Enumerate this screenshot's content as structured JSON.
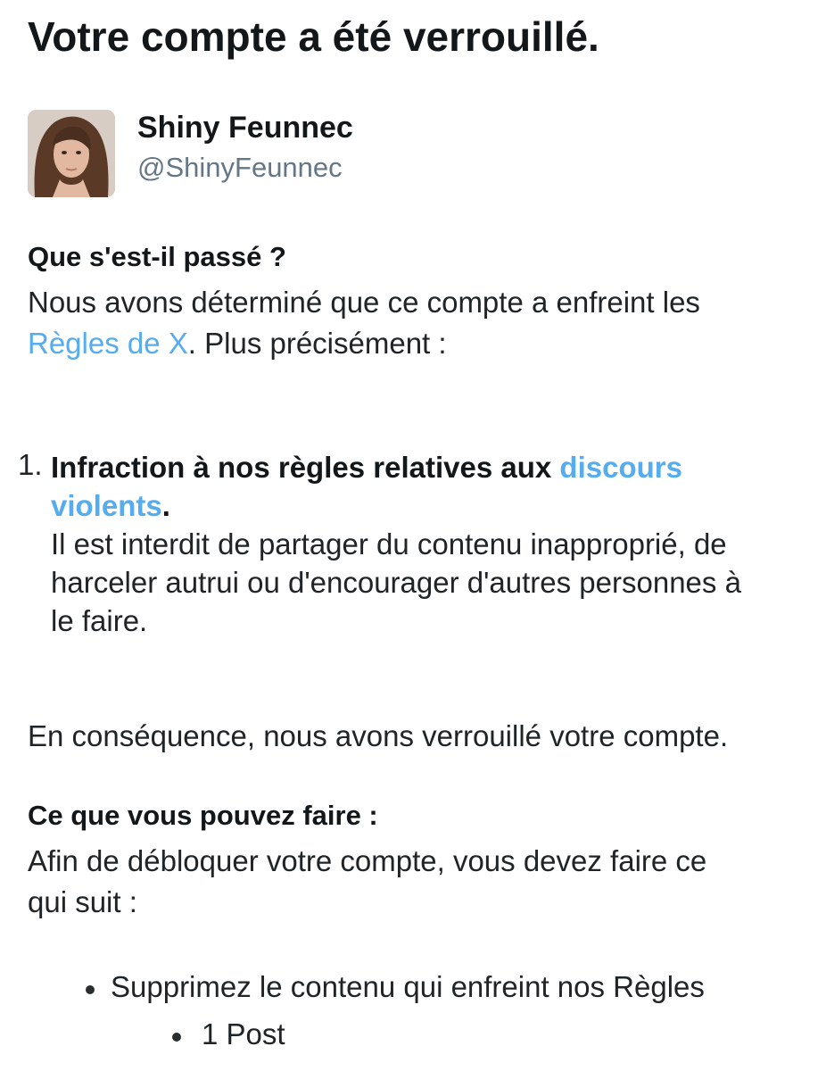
{
  "page_title": "Votre compte a été verrouillé.",
  "profile": {
    "display_name": "Shiny Feunnec",
    "handle": "@ShinyFeunnec"
  },
  "what_happened": {
    "heading": "Que s'est-il passé ?",
    "line1": "Nous avons déterminé que ce compte a enfreint les",
    "rules_link": "Règles de X",
    "line2_rest": ". Plus précisément :"
  },
  "violations": [
    {
      "number": "1.",
      "title_prefix": "Infraction à nos règles relatives aux ",
      "title_link_part1": "discours",
      "title_link_part2": "violents",
      "title_suffix": ".",
      "description_lines": [
        "Il est interdit de partager du contenu inapproprié, de",
        "harceler autrui ou d'encourager d'autres personnes à",
        "le faire."
      ]
    }
  ],
  "consequence": "En conséquence, nous avons verrouillé votre compte.",
  "what_you_can_do": {
    "heading": "Ce que vous pouvez faire :",
    "line1": "Afin de débloquer votre compte, vous devez faire ce",
    "line2": "qui suit :",
    "action": "Supprimez le contenu qui enfreint nos Règles",
    "sub_item": "1 Post"
  },
  "colors": {
    "link": "#55acee",
    "text": "#202427",
    "secondary_text": "#657786"
  }
}
